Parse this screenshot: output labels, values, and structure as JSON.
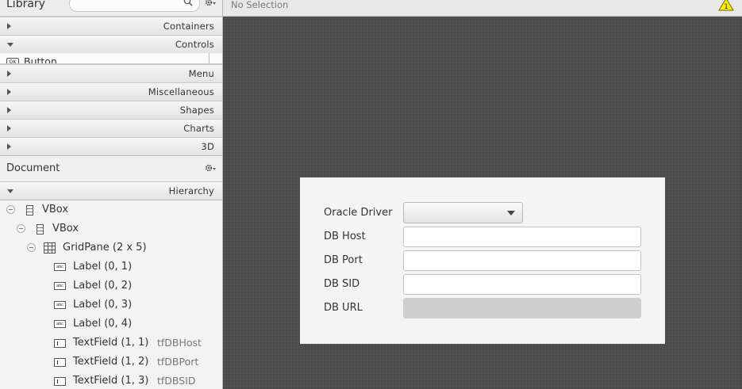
{
  "library": {
    "title": "Library",
    "search_value": "",
    "sections": [
      {
        "label": "Containers",
        "expanded": false
      },
      {
        "label": "Controls",
        "expanded": true
      },
      {
        "label": "Menu",
        "expanded": false
      },
      {
        "label": "Miscellaneous",
        "expanded": false
      },
      {
        "label": "Shapes",
        "expanded": false
      },
      {
        "label": "Charts",
        "expanded": false
      },
      {
        "label": "3D",
        "expanded": false
      }
    ],
    "controls_items": [
      {
        "icon_text": "OK",
        "label": "Button"
      }
    ]
  },
  "document": {
    "title": "Document",
    "hierarchy_label": "Hierarchy",
    "tree": [
      {
        "label": "VBox",
        "icon": "vbox-icon"
      },
      {
        "label": "VBox",
        "icon": "vbox-icon"
      },
      {
        "label": "GridPane (2 x 5)",
        "icon": "gridpane-icon"
      },
      {
        "label": "Label (0, 1)",
        "icon": "label-icon",
        "icon_text": "abc"
      },
      {
        "label": "Label (0, 2)",
        "icon": "label-icon",
        "icon_text": "abc"
      },
      {
        "label": "Label (0, 3)",
        "icon": "label-icon",
        "icon_text": "abc"
      },
      {
        "label": "Label (0, 4)",
        "icon": "label-icon",
        "icon_text": "abc"
      },
      {
        "label": "TextField (1, 1)",
        "fx_id": "tfDBHost",
        "icon": "textfield-icon"
      },
      {
        "label": "TextField (1, 2)",
        "fx_id": "tfDBPort",
        "icon": "textfield-icon"
      },
      {
        "label": "TextField (1, 3)",
        "fx_id": "tfDBSID",
        "icon": "textfield-icon"
      }
    ]
  },
  "content": {
    "selection_status": "No Selection",
    "warning_count": "1",
    "form": {
      "fields": [
        {
          "label": "Oracle Driver",
          "type": "combo",
          "value": ""
        },
        {
          "label": "DB Host",
          "type": "text",
          "value": ""
        },
        {
          "label": "DB Port",
          "type": "text",
          "value": ""
        },
        {
          "label": "DB SID",
          "type": "text",
          "value": ""
        },
        {
          "label": "DB URL",
          "type": "text",
          "value": "",
          "disabled": true
        }
      ]
    }
  },
  "colors": {
    "canvas": "#4b4b4b",
    "panel": "#f3f3f3",
    "warning": "#ffee00"
  }
}
